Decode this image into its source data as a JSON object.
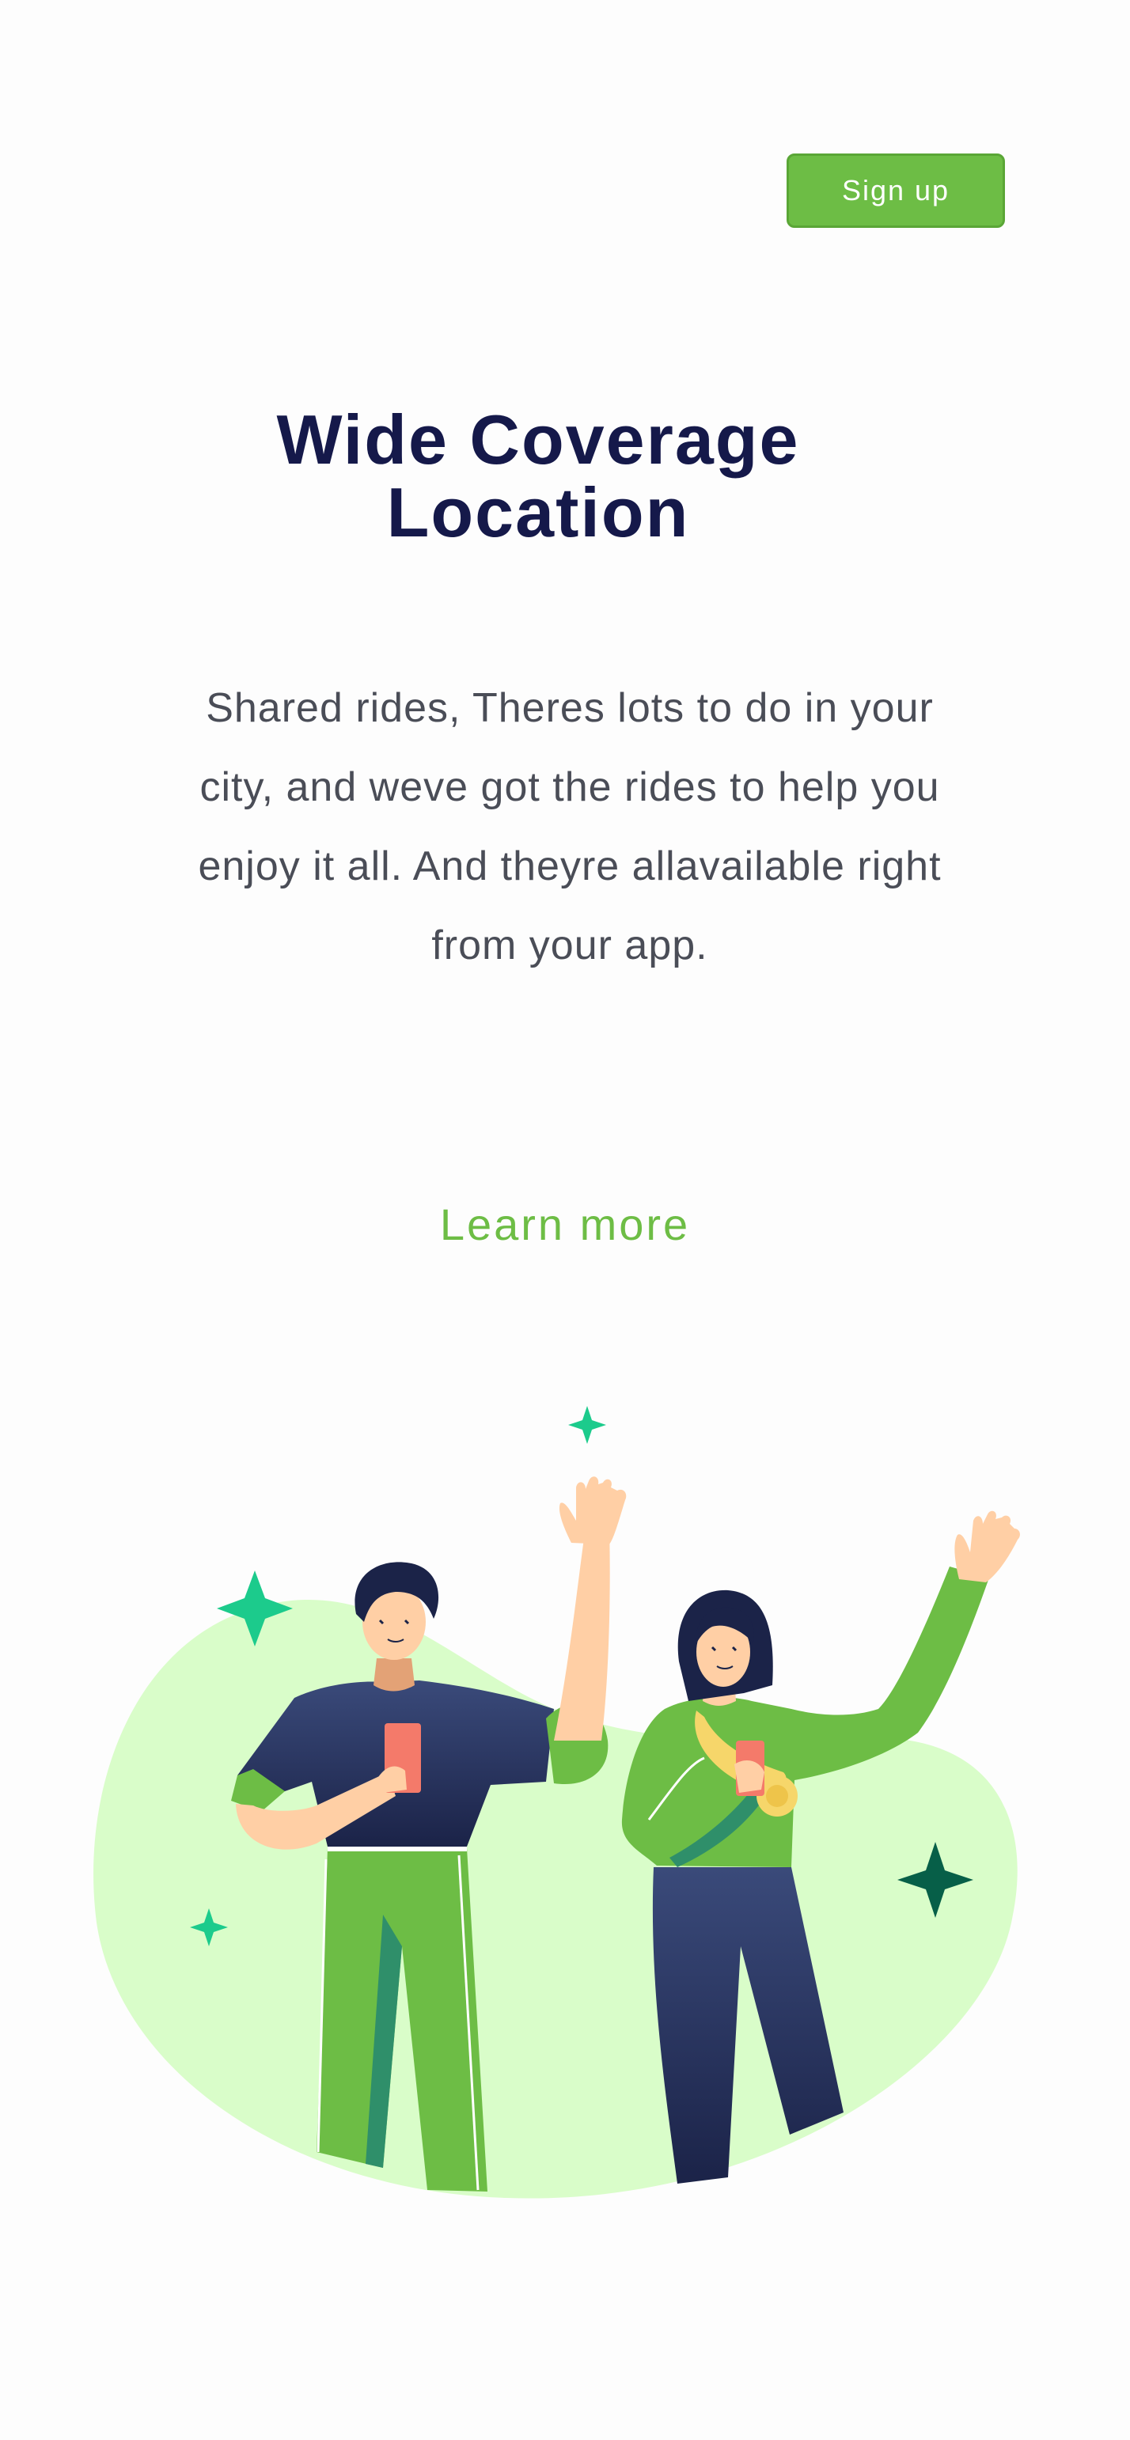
{
  "header": {
    "signup_label": "Sign up"
  },
  "hero": {
    "title": "Wide Coverage Location",
    "description": "Shared rides, Theres lots to do in your city, and weve got the rides to help you enjoy it all. And theyre allavailable right from your app.",
    "learn_more_label": "Learn more"
  },
  "illustration": {
    "subject": "two-people-waving-with-phones",
    "colors": {
      "blob": "#d9fdc9",
      "accent_green": "#6dbd45",
      "navy": "#1d2a57",
      "sparkle_light": "#1ccb8c",
      "sparkle_dark": "#075f48",
      "skin": "#ffcfa5",
      "phone": "#f47a6a"
    }
  },
  "theme": {
    "accent": "#6dbd45",
    "title_color": "#15194a",
    "text_color": "#4a4d57"
  }
}
